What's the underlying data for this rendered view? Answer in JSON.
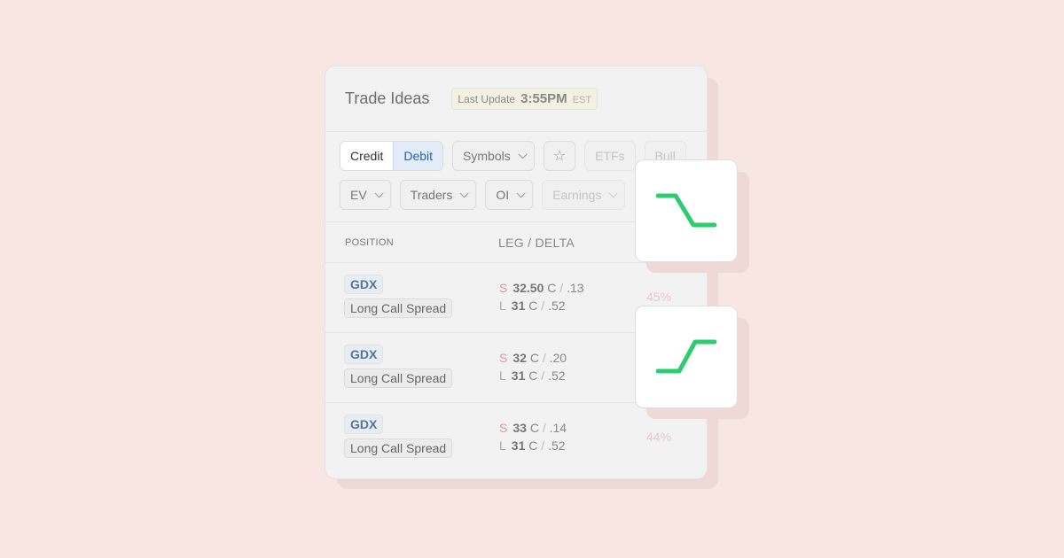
{
  "header": {
    "title": "Trade Ideas",
    "update_label": "Last Update",
    "update_time": "3:55PM",
    "update_tz": "EST"
  },
  "filters": {
    "segment": [
      "Credit",
      "Debit"
    ],
    "row1": [
      "Symbols",
      "ETFs",
      "Bull"
    ],
    "row2": [
      "EV",
      "Traders",
      "OI",
      "Earnings"
    ]
  },
  "table": {
    "headers": [
      "POSITION",
      "LEG / DELTA"
    ],
    "rows": [
      {
        "ticker": "GDX",
        "strategy": "Long Call Spread",
        "s_side": "S",
        "s_strike": "32.50",
        "s_type": "C",
        "s_delta": ".13",
        "l_side": "L",
        "l_strike": "31",
        "l_type": "C",
        "l_delta": ".52",
        "pct": "45%"
      },
      {
        "ticker": "GDX",
        "strategy": "Long Call Spread",
        "s_side": "S",
        "s_strike": "32",
        "s_type": "C",
        "s_delta": ".20",
        "l_side": "L",
        "l_strike": "31",
        "l_type": "C",
        "l_delta": ".52",
        "pct": ""
      },
      {
        "ticker": "GDX",
        "strategy": "Long Call Spread",
        "s_side": "S",
        "s_strike": "33",
        "s_type": "C",
        "s_delta": ".14",
        "l_side": "L",
        "l_strike": "31",
        "l_type": "C",
        "l_delta": ".52",
        "pct": "44%"
      }
    ]
  },
  "icons": {
    "star": "star-icon",
    "bearish": "bearish-step-icon",
    "bullish": "bullish-step-icon"
  },
  "colors": {
    "accent_green": "#2ecc71",
    "debit_active": "#2d5ea8",
    "background": "#f8e6e3"
  }
}
